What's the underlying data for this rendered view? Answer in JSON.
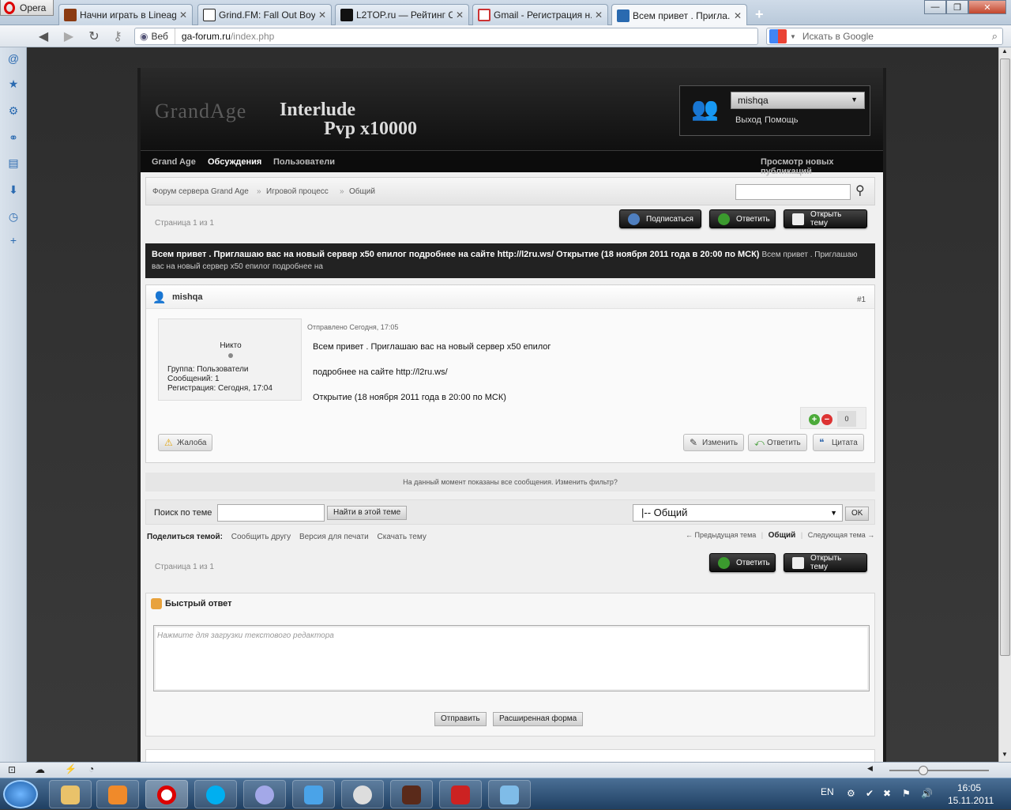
{
  "browser": {
    "menu_label": "Opera",
    "tabs": [
      {
        "label": "Начни играть в Lineag...",
        "color": "#8a3a12"
      },
      {
        "label": "Grind.FM: Fall Out Boy ...",
        "color": "#222"
      },
      {
        "label": "L2TOP.ru — Рейтинг С...",
        "color": "#111"
      },
      {
        "label": "Gmail - Регистрация н...",
        "color": "#c33"
      },
      {
        "label": "Всем привет . Пригла...",
        "color": "#2a6ab0"
      }
    ],
    "address_prefix": "Веб",
    "address_host": "ga-forum.ru",
    "address_path": "/index.php",
    "search_placeholder": "Искать в Google"
  },
  "header": {
    "logo_text": "GrandAge",
    "title1": "Interlude",
    "title2": "Pvp x10000",
    "username": "mishqa",
    "logout": "Выход",
    "help": "Помощь"
  },
  "nav": {
    "items": [
      "Grand Age",
      "Обсуждения",
      "Пользователи"
    ],
    "new_posts": "Просмотр новых публикаций"
  },
  "breadcrumb": [
    "Форум сервера Grand Age",
    "Игровой процесс",
    "Общий"
  ],
  "pagination": "Страница 1 из 1",
  "buttons": {
    "subscribe": "Подписаться",
    "reply": "Ответить",
    "new_topic": "Открыть тему"
  },
  "topic": {
    "title": "Всем привет . Приглашаю вас на новый сервер x50 епилог подробнее на сайте http://l2ru.ws/ Открытие (18 ноября 2011 года в 20:00 по МСК)",
    "desc": "Всем привет . Приглашаю вас на новый сервер x50 епилог подробнее на"
  },
  "post": {
    "author": "mishqa",
    "number": "#1",
    "rank": "Никто",
    "group": "Группа: Пользователи",
    "posts": "Сообщений: 1",
    "registered": "Регистрация: Сегодня, 17:04",
    "posted": "Отправлено Сегодня, 17:05",
    "lines": [
      "Всем привет . Приглашаю вас на новый сервер x50 епилог",
      "подробнее на сайте http://l2ru.ws/",
      "Открытие (18 ноября 2011 года в 20:00 по МСК)"
    ],
    "reputation": "0",
    "report": "Жалоба",
    "edit": "Изменить",
    "reply": "Ответить",
    "quote": "Цитата"
  },
  "filter_text": "На данный момент показаны все сообщения. Изменить фильтр?",
  "topic_search": {
    "label": "Поиск по теме",
    "button": "Найти в этой теме",
    "forum_select": "|-- Общий",
    "ok": "OK"
  },
  "share": {
    "label": "Поделиться темой:",
    "links": [
      "Сообщить другу",
      "Версия для печати",
      "Скачать тему"
    ]
  },
  "topic_nav": {
    "prev": "← Предыдущая тема",
    "current": "Общий",
    "next": "Следующая тема →"
  },
  "quick_reply": {
    "title": "Быстрый ответ",
    "placeholder": "Нажмите для загрузки текстового редактора",
    "send": "Отправить",
    "advanced": "Расширенная форма"
  },
  "taskbar": {
    "lang": "EN",
    "time": "16:05",
    "date": "15.11.2011"
  }
}
